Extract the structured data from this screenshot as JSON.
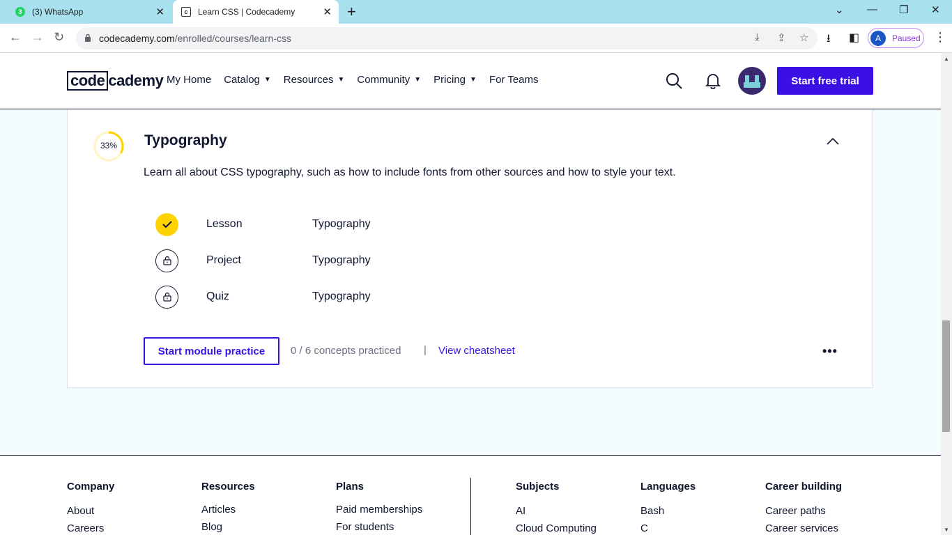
{
  "browser": {
    "tabs": [
      {
        "title": "(3) WhatsApp",
        "favicon_text": "3"
      },
      {
        "title": "Learn CSS | Codecademy",
        "favicon_text": "c"
      }
    ],
    "url_host": "codecademy.com",
    "url_path": "/enrolled/courses/learn-css",
    "profile_initial": "A",
    "profile_status": "Paused"
  },
  "header": {
    "logo_left": "code",
    "logo_right": "cademy",
    "nav": [
      {
        "label": "My Home",
        "dropdown": false
      },
      {
        "label": "Catalog",
        "dropdown": true
      },
      {
        "label": "Resources",
        "dropdown": true
      },
      {
        "label": "Community",
        "dropdown": true
      },
      {
        "label": "Pricing",
        "dropdown": true
      },
      {
        "label": "For Teams",
        "dropdown": false
      }
    ],
    "cta_label": "Start free trial"
  },
  "module": {
    "progress_label": "33%",
    "progress_fraction": 0.33,
    "title": "Typography",
    "description": "Learn all about CSS typography, such as how to include fonts from other sources and how to style your text.",
    "items": [
      {
        "type": "Lesson",
        "name": "Typography",
        "status": "complete"
      },
      {
        "type": "Project",
        "name": "Typography",
        "status": "locked"
      },
      {
        "type": "Quiz",
        "name": "Typography",
        "status": "locked"
      }
    ],
    "practice_button": "Start module practice",
    "concepts_text": "0 / 6 concepts practiced",
    "separator": "|",
    "cheatsheet_link": "View cheatsheet"
  },
  "footer": {
    "columns": [
      {
        "heading": "Company",
        "links": [
          "About",
          "Careers"
        ]
      },
      {
        "heading": "Resources",
        "links": [
          "Articles",
          "Blog"
        ]
      },
      {
        "heading": "Plans",
        "links": [
          "Paid memberships",
          "For students"
        ]
      },
      {
        "heading": "Subjects",
        "links": [
          "AI",
          "Cloud Computing"
        ]
      },
      {
        "heading": "Languages",
        "links": [
          "Bash",
          "C"
        ]
      },
      {
        "heading": "Career building",
        "links": [
          "Career paths",
          "Career services"
        ]
      }
    ]
  },
  "colors": {
    "brand": "#3a10e5",
    "navy": "#10162f",
    "progress": "#ffd300",
    "page_bg": "#f5fcff"
  }
}
